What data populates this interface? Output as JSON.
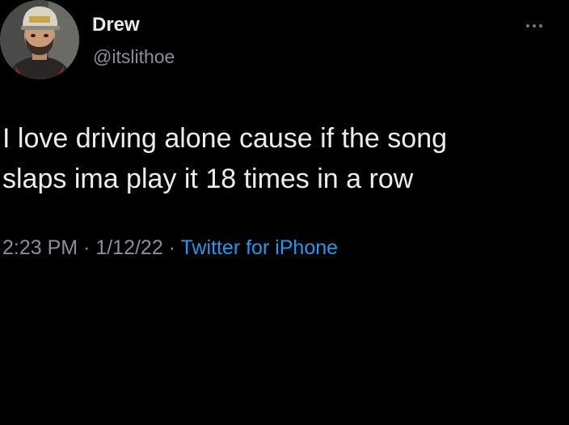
{
  "author": {
    "display_name": "Drew",
    "handle": "@itslithoe"
  },
  "tweet": {
    "lines": [
      "I love driving alone cause if the song",
      "slaps ima play it 18 times in a row"
    ]
  },
  "meta": {
    "time": "2:23 PM",
    "separator": " · ",
    "date": "1/12/22",
    "source": "Twitter for iPhone"
  },
  "icons": {
    "more": "more-dots-icon",
    "avatar": "profile-avatar"
  },
  "colors": {
    "background": "#000000",
    "text": "#e7e9ea",
    "secondary": "#8a9097",
    "link": "#1d9bf0"
  }
}
